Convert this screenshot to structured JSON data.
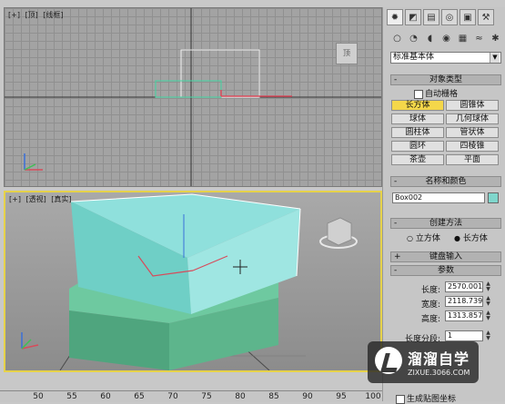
{
  "viewport_top": {
    "labels": [
      "[+]",
      "[顶]",
      "[线框]"
    ],
    "navcube_text": "顶"
  },
  "viewport_perspective": {
    "labels": [
      "[+]",
      "[透视]",
      "[真实]"
    ]
  },
  "command_panel": {
    "tabs": [
      "✹",
      "◩",
      "▤",
      "◎",
      "▣",
      "⚒"
    ],
    "subtabs": [
      "○",
      "◔",
      "◖",
      "◉",
      "▦",
      "≈",
      "✱"
    ],
    "dropdown_value": "标准基本体",
    "object_type": {
      "header": "对象类型",
      "autogrid_label": "自动栅格",
      "buttons": [
        "长方体",
        "圆锥体",
        "球体",
        "几何球体",
        "圆柱体",
        "管状体",
        "圆环",
        "四棱锥",
        "茶壶",
        "平面"
      ]
    },
    "name_color": {
      "header": "名称和颜色",
      "name_value": "Box002",
      "swatch_color": "#7fd6cc"
    },
    "creation_method": {
      "header": "创建方法",
      "options": [
        "立方体",
        "长方体"
      ],
      "selected": "长方体"
    },
    "keyboard_entry": {
      "header": "键盘输入"
    },
    "parameters": {
      "header": "参数",
      "length_label": "长度:",
      "length_value": "2570.001",
      "width_label": "宽度:",
      "width_value": "2118.739",
      "height_label": "高度:",
      "height_value": "1313.857",
      "length_segs_label": "长度分段:",
      "length_segs_value": "1",
      "gen_mapping_label": "生成贴图坐标"
    }
  },
  "ruler": [
    "50",
    "55",
    "60",
    "65",
    "70",
    "75",
    "80",
    "85",
    "90",
    "95",
    "100"
  ],
  "watermark": {
    "title": "溜溜自学",
    "subtitle": "ZIXUE.3066.COM"
  }
}
